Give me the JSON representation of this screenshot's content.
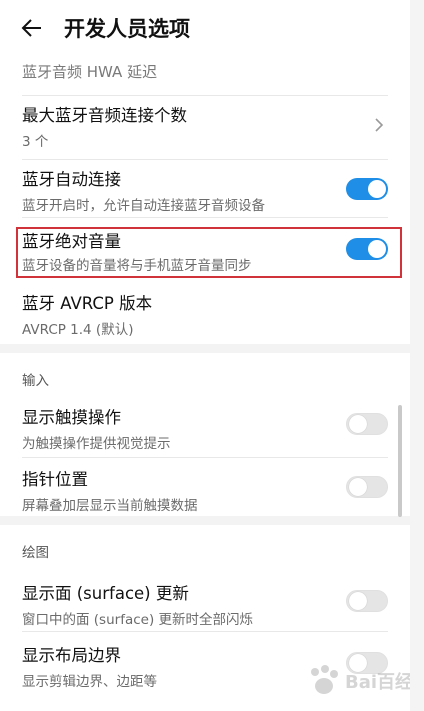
{
  "header": {
    "title": "开发人员选项"
  },
  "partial_top_item": {
    "title": "蓝牙音频 HWA 延迟"
  },
  "bluetooth_items": [
    {
      "title": "最大蓝牙音频连接个数",
      "subtitle": "3 个",
      "control": "chevron"
    },
    {
      "title": "蓝牙自动连接",
      "subtitle": "蓝牙开启时，允许自动连接蓝牙音频设备",
      "control": "toggle",
      "checked": true
    },
    {
      "title": "蓝牙绝对音量",
      "subtitle": "蓝牙设备的音量将与手机蓝牙音量同步",
      "control": "toggle",
      "checked": true,
      "highlighted": true
    },
    {
      "title": "蓝牙 AVRCP 版本",
      "subtitle": "AVRCP 1.4 (默认)",
      "control": "none"
    }
  ],
  "sections": [
    {
      "header": "输入",
      "items": [
        {
          "title": "显示触摸操作",
          "subtitle": "为触摸操作提供视觉提示",
          "checked": false
        },
        {
          "title": "指针位置",
          "subtitle": "屏幕叠加层显示当前触摸数据",
          "checked": false
        }
      ]
    },
    {
      "header": "绘图",
      "items": [
        {
          "title": "显示面 (surface) 更新",
          "subtitle": "窗口中的面 (surface) 更新时全部闪烁",
          "checked": false
        },
        {
          "title": "显示布局边界",
          "subtitle": "显示剪辑边界、边距等",
          "checked": false
        }
      ]
    }
  ],
  "watermark": {
    "text": "Bai百经验"
  },
  "colors": {
    "accent": "#1e8ee6",
    "highlight": "#d0333a",
    "toggle_off": "#e5e5e5"
  },
  "icons": {
    "back": "arrow-left-icon",
    "chevron": "chevron-right-icon"
  }
}
